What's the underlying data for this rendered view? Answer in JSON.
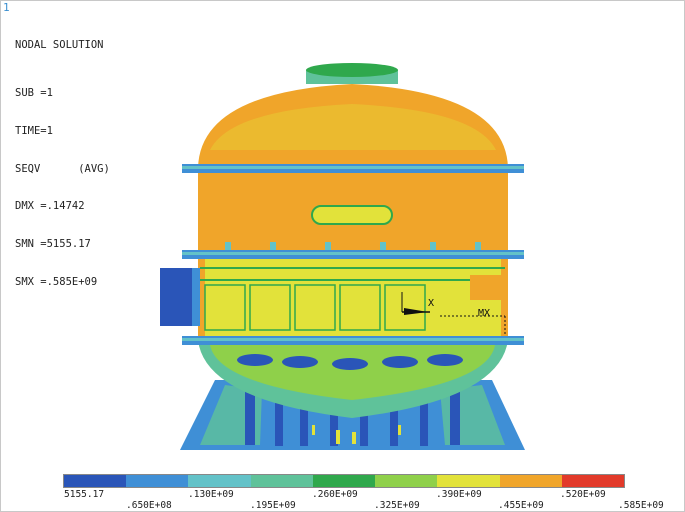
{
  "window": {
    "number": "1"
  },
  "info": {
    "title": "NODAL SOLUTION",
    "sub": "SUB =1",
    "time": "TIME=1",
    "seqv": "SEQV      (AVG)",
    "dmx": "DMX =.14742",
    "smn": "SMN =5155.17",
    "smx": "SMX =.585E+09"
  },
  "markers": {
    "axis_x": "X",
    "max_label": "MX"
  },
  "legend": {
    "colors": [
      "#2a55b8",
      "#3f8fd6",
      "#63c2c8",
      "#5fc29a",
      "#2fa84c",
      "#8fd04a",
      "#e2e23a",
      "#f0a52a",
      "#e23a2a"
    ],
    "top_labels": [
      "5155.17",
      ".130E+09",
      ".260E+09",
      ".390E+09",
      ".520E+09"
    ],
    "bottom_labels": [
      ".650E+08",
      ".195E+09",
      ".325E+09",
      ".455E+09",
      ".585E+09"
    ]
  }
}
